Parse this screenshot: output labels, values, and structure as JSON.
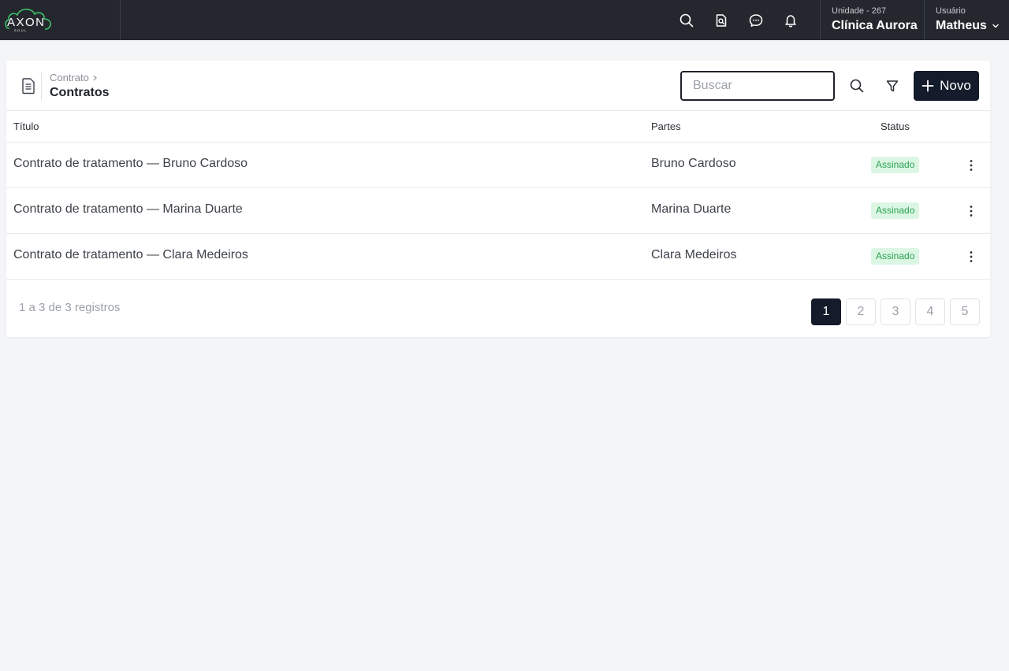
{
  "topbar": {
    "logo_text": "AXON",
    "logo_subtext": "SOUL",
    "unit_label": "Unidade - 267",
    "unit_name": "Clínica Aurora",
    "user_label": "Usuário",
    "user_name": "Matheus",
    "icons": [
      "search-icon",
      "document-search-icon",
      "chat-icon",
      "bell-icon",
      "chevron-down-icon"
    ]
  },
  "header": {
    "breadcrumb_parent": "Contrato",
    "page_title": "Contratos",
    "search_placeholder": "Buscar",
    "new_button_label": "Novo",
    "icons": [
      "document-icon",
      "search-icon",
      "filter-icon",
      "plus-icon"
    ]
  },
  "table": {
    "columns": {
      "title": "Título",
      "parties": "Partes",
      "status": "Status"
    },
    "rows": [
      {
        "title": "Contrato de tratamento — Bruno Cardoso",
        "parties": "Bruno Cardoso",
        "status": "Assinado"
      },
      {
        "title": "Contrato de tratamento — Marina Duarte",
        "parties": "Marina Duarte",
        "status": "Assinado"
      },
      {
        "title": "Contrato de tratamento — Clara Medeiros",
        "parties": "Clara Medeiros",
        "status": "Assinado"
      }
    ]
  },
  "footer": {
    "records_text": "1 a 3 de 3 registros",
    "pages": [
      "1",
      "2",
      "3",
      "4",
      "5"
    ],
    "active_page": "1"
  },
  "colors": {
    "topbar_bg": "#24282e",
    "primary_dark": "#141b2b",
    "status_green": "#2aa351",
    "status_green_bg": "#dcf6e4",
    "logo_green": "#3fbf6a"
  }
}
